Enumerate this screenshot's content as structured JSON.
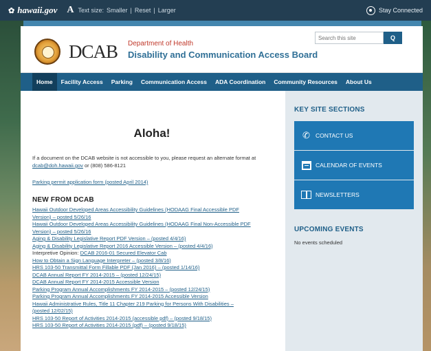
{
  "topbar": {
    "gov_logo": "hawaii.gov",
    "text_size_label": "Text size:",
    "smaller": "Smaller",
    "reset": "Reset",
    "larger": "Larger",
    "stay_connected": "Stay Connected"
  },
  "header": {
    "logo_text": "DCAB",
    "department": "Department of Health",
    "title": "Disability and Communication Access Board",
    "search_placeholder": "Search this site",
    "search_button": "Q"
  },
  "nav": {
    "items": [
      {
        "label": "Home",
        "active": true
      },
      {
        "label": "Facility Access"
      },
      {
        "label": "Parking"
      },
      {
        "label": "Communication Access"
      },
      {
        "label": "ADA Coordination"
      },
      {
        "label": "Community Resources"
      },
      {
        "label": "About Us"
      }
    ]
  },
  "main": {
    "heading": "Aloha!",
    "intro_text": "If a document on the DCAB website is not accessible to you, please request an alternate format at ",
    "intro_email": "dcab@doh.hawaii.gov",
    "intro_phone": " or (808) 586-8121",
    "permit_link": "Parking permit application form (posted April 2014)",
    "new_title": "NEW FROM DCAB",
    "news_items": [
      "Hawaii Outdoor Developed Areas Accessibility Guidelines (HODAAG Final Accessible PDF",
      "Version) – posted 5/26/16",
      "Hawaii Outdoor Developed Areas Accessibility Guidelines (HODAAG Final Non-Accessible PDF",
      "Version) – posted 5/26/16",
      "Aging & Disability Legislative Report PDF Version – (posted 4/4/16)",
      "Aging & Disability Legislative Report 2016 Accessible Version – (posted 4/4/16)",
      "How to Obtain a Sign Language Interpreter – (posted 3/8/16)",
      "HRS 103-50 Transmittal Form Fillable PDF (Jan 2016) – (posted 1/14/16)",
      "DCAB Annual Report FY 2014-2015 – (posted 12/24/15)",
      "DCAB Annual Report FY 2014-2015 Accessible Version",
      "Parking Program Annual Accomplishments FY 2014-2015 – (posted 12/24/15)",
      "Parking Program Annual Accomplishments FY 2014-2015 Accessible Version",
      "Hawaii Administrative Rules, Title 11 Chapter 219 Parking for Persons With Disabilities –",
      "(posted 12/02/15)",
      "HRS 103-50 Report of Activities 2014-2015 (accessible pdf) – (posted 9/18/15)",
      "HRS 103-50 Report of Activities 2014-2015 (pdf) – (posted 9/18/15)"
    ],
    "interpretive_label": "Interpretive Opinion: ",
    "interpretive_link": "DCAB 2016-01 Secured Elevator Cab"
  },
  "sidebar": {
    "key_title": "KEY SITE SECTIONS",
    "contact": "CONTACT US",
    "calendar": "CALENDAR OF EVENTS",
    "newsletters": "NEWSLETTERS",
    "upcoming_title": "UPCOMING EVENTS",
    "no_events": "No events scheduled"
  },
  "colors": {
    "brand_blue": "#1f5f88",
    "block_blue": "#1f78b4",
    "accent_red": "#c0392b",
    "topbar": "#233e52"
  }
}
